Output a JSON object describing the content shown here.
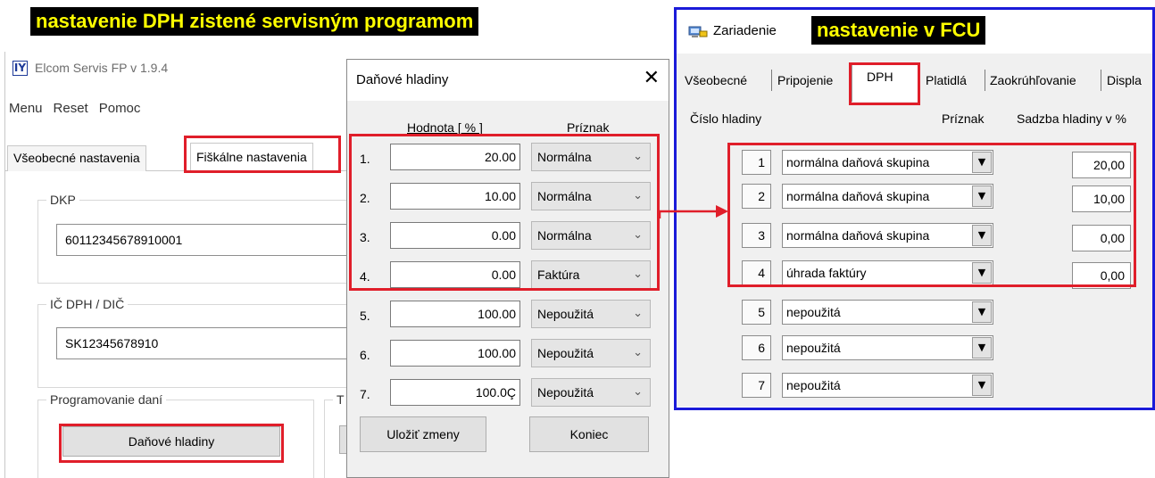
{
  "captions": {
    "left": "nastavenie DPH zistené servisným programom",
    "right": "nastavenie v  FCU"
  },
  "left_window": {
    "title": "Elcom Servis FP v 1.9.4",
    "icon": "elcom-app-icon",
    "menu": [
      "Menu",
      "Reset",
      "Pomoc"
    ],
    "tabs": [
      "Všeobecné nastavenia",
      "Fiškálne nastavenia"
    ],
    "dkp_label": "DKP",
    "dkp_value": "60112345678910001",
    "icdph_label": "IČ DPH / DIČ",
    "icdph_value": "SK12345678910",
    "programming_label": "Programovanie daní",
    "second_group_label": "T",
    "tax_levels_button": "Daňové hladiny"
  },
  "dialog": {
    "title": "Daňové hladiny",
    "close_icon": "close-icon",
    "col_value": "Hodnota [ % ]",
    "col_flag": "Príznak",
    "rows": [
      {
        "num": "1.",
        "value": "20.00",
        "flag": "Normálna"
      },
      {
        "num": "2.",
        "value": "10.00",
        "flag": "Normálna"
      },
      {
        "num": "3.",
        "value": "0.00",
        "flag": "Normálna"
      },
      {
        "num": "4.",
        "value": "0.00",
        "flag": "Faktúra"
      },
      {
        "num": "5.",
        "value": "100.00",
        "flag": "Nepoužitá"
      },
      {
        "num": "6.",
        "value": "100.00",
        "flag": "Nepoužitá"
      },
      {
        "num": "7.",
        "value": "100.0Ç",
        "flag": "Nepoužitá"
      }
    ],
    "save_button": "Uložiť zmeny",
    "end_button": "Koniec"
  },
  "right_window": {
    "title": "Zariadenie",
    "icon": "device-icon",
    "tabs": [
      "Všeobecné",
      "Pripojenie",
      "DPH",
      "Platidlá",
      "Zaokrúhľovanie",
      "Displa"
    ],
    "col_level": "Číslo hladiny",
    "col_flag": "Príznak",
    "col_rate": "Sadzba hladiny v %",
    "rows": [
      {
        "num": "1",
        "flag": "normálna daňová skupina",
        "rate": "20,00"
      },
      {
        "num": "2",
        "flag": "normálna daňová skupina",
        "rate": "10,00"
      },
      {
        "num": "3",
        "flag": "normálna daňová skupina",
        "rate": "0,00"
      },
      {
        "num": "4",
        "flag": "úhrada faktúry",
        "rate": "0,00"
      },
      {
        "num": "5",
        "flag": "nepoužitá",
        "rate": ""
      },
      {
        "num": "6",
        "flag": "nepoužitá",
        "rate": ""
      },
      {
        "num": "7",
        "flag": "nepoužitá",
        "rate": ""
      }
    ]
  },
  "colors": {
    "highlight_red": "#e01e2a",
    "frame_blue": "#1b1bd9",
    "caption_bg": "#000000",
    "caption_text": "#ffff00"
  }
}
